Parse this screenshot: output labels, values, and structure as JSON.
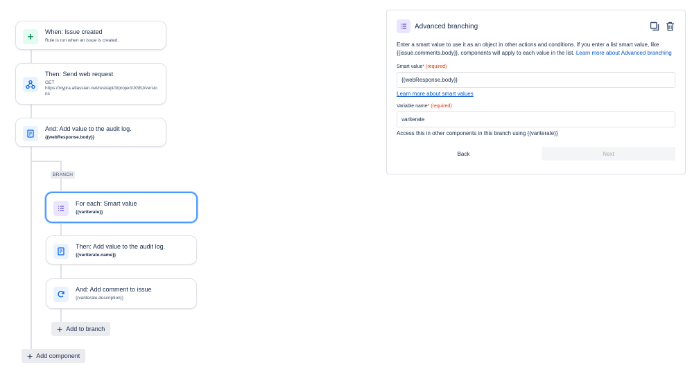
{
  "flow": {
    "trigger": {
      "title": "When: Issue created",
      "subtitle": "Rule is run when an issue is created."
    },
    "web_request": {
      "title": "Then: Send web request",
      "method": "GET",
      "url": "https://myjira.atlassian.net/rest/api/3/project/JGBJ/versions"
    },
    "audit_log": {
      "title": "And: Add value to the audit log.",
      "value": "{{webResponse.body}}"
    },
    "branch_label": "BRANCH",
    "for_each": {
      "title": "For each: Smart value",
      "value": "{{variterate}}"
    },
    "audit_log_2": {
      "title": "Then: Add value to the audit log.",
      "value": "{{variterate.name}}"
    },
    "add_comment": {
      "title": "And: Add comment to issue",
      "value": "{{variterate.description}}"
    },
    "add_to_branch_label": "Add to branch",
    "add_component_label": "Add component"
  },
  "panel": {
    "title": "Advanced branching",
    "description": "Enter a smart value to use it as an object in other actions and conditions. If you enter a list smart value, like {{issue.comments.body}}, components will apply to each value in the list. ",
    "description_link": "Learn more about Advanced branching",
    "smart_value_label": "Smart value",
    "required_marker": "*",
    "required_text": "(required)",
    "smart_value": "{{webResponse.body}}",
    "smart_values_link": "Learn more about smart values",
    "variable_name_label": "Variable name",
    "variable_name": "variterate",
    "variable_help": "Access this in other components in this branch using {{variterate}}",
    "back_label": "Back",
    "next_label": "Next"
  },
  "icons": {
    "trigger": "plus-icon",
    "web_request": "webhook-icon",
    "audit_log": "document-icon",
    "for_each": "list-icon",
    "add_comment": "refresh-icon",
    "copy": "copy-icon",
    "delete": "trash-icon"
  },
  "colors": {
    "selected_border": "#4c9aff",
    "link": "#0052cc",
    "required": "#de350b",
    "connector": "#dfe1e6"
  }
}
